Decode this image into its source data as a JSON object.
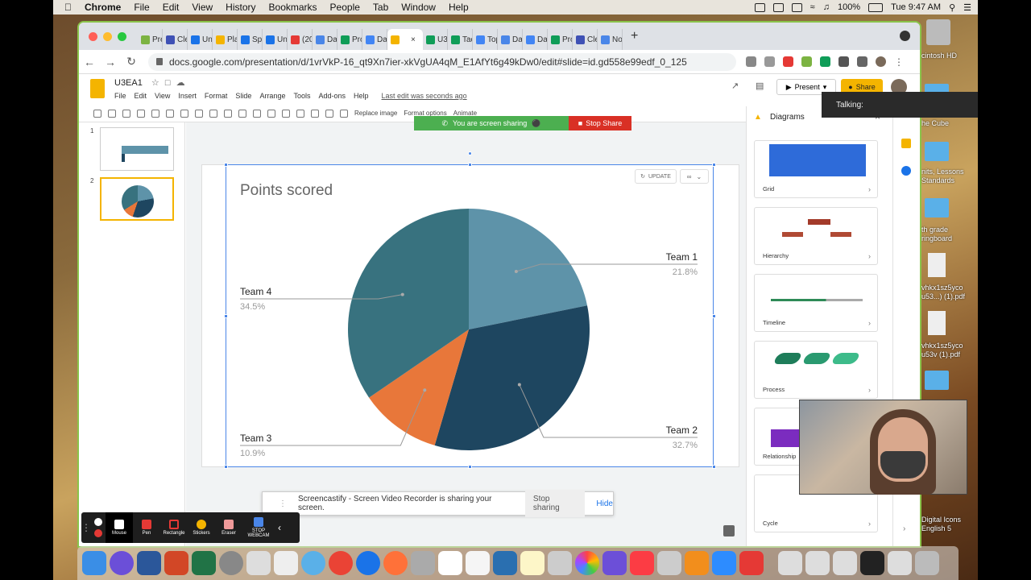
{
  "menubar": {
    "apple": "",
    "items": [
      "Chrome",
      "File",
      "Edit",
      "View",
      "History",
      "Bookmarks",
      "People",
      "Tab",
      "Window",
      "Help"
    ],
    "battery": "100%",
    "clock": "Tue 9:47 AM"
  },
  "tabs": [
    {
      "label": "Pre",
      "color": "#7cb342"
    },
    {
      "label": "Cle",
      "color": "#3f51b5"
    },
    {
      "label": "Un",
      "color": "#1a73e8"
    },
    {
      "label": "Pla",
      "color": "#f4b400"
    },
    {
      "label": "Sp",
      "color": "#1a73e8"
    },
    {
      "label": "Un",
      "color": "#1a73e8"
    },
    {
      "label": "(20",
      "color": "#e53935"
    },
    {
      "label": "Da",
      "color": "#4a86e8"
    },
    {
      "label": "Pro",
      "color": "#0f9d58"
    },
    {
      "label": "Da",
      "color": "#4285f4"
    },
    {
      "label": "",
      "color": "#f4b400",
      "active": true
    },
    {
      "label": "U3",
      "color": "#0f9d58"
    },
    {
      "label": "Tac",
      "color": "#0f9d58"
    },
    {
      "label": "Top",
      "color": "#4285f4"
    },
    {
      "label": "Da",
      "color": "#4a86e8"
    },
    {
      "label": "Da",
      "color": "#4285f4"
    },
    {
      "label": "Pro",
      "color": "#0f9d58"
    },
    {
      "label": "Cle",
      "color": "#3f51b5"
    },
    {
      "label": "No",
      "color": "#4a86e8"
    }
  ],
  "omnibox": {
    "url": "docs.google.com/presentation/d/1vrVkP-16_qt9Xn7ier-xkVgUA4qM_E1AfYt6g49kDw0/edit#slide=id.gd558e99edf_0_125"
  },
  "doc": {
    "title": "U3EA1",
    "menu": [
      "File",
      "Edit",
      "View",
      "Insert",
      "Format",
      "Slide",
      "Arrange",
      "Tools",
      "Add-ons",
      "Help"
    ],
    "last_edit": "Last edit was seconds ago",
    "present_label": "Present",
    "share_label": "Share"
  },
  "toolbar_labels": {
    "replace_image": "Replace image",
    "format_options": "Format options",
    "animate": "Animate"
  },
  "screen_share": {
    "message": "You are screen sharing",
    "stop": "Stop Share"
  },
  "chart_buttons": {
    "update": "UPDATE"
  },
  "chart_data": {
    "type": "pie",
    "title": "Points scored",
    "series": [
      {
        "name": "Team 1",
        "value": 21.8,
        "label": "21.8%",
        "color": "#5e93a9"
      },
      {
        "name": "Team 2",
        "value": 32.7,
        "label": "32.7%",
        "color": "#1e4660"
      },
      {
        "name": "Team 3",
        "value": 10.9,
        "label": "10.9%",
        "color": "#e8773a"
      },
      {
        "name": "Team 4",
        "value": 34.5,
        "label": "34.5%",
        "color": "#38727f"
      }
    ]
  },
  "filmstrip": {
    "slides": [
      "1",
      "2"
    ]
  },
  "diagrams": {
    "title": "Diagrams",
    "items": [
      "Grid",
      "Hierarchy",
      "Timeline",
      "Process",
      "Relationship",
      "Cycle"
    ]
  },
  "talking": "Talking:",
  "notice": {
    "text": "Screencastify - Screen Video Recorder is sharing your screen.",
    "stop": "Stop sharing",
    "hide": "Hide"
  },
  "screencastify_tools": [
    {
      "label": "Mouse",
      "color": "#ffffff"
    },
    {
      "label": "Pen",
      "color": "#e53935"
    },
    {
      "label": "Rectangle",
      "color": "#e53935"
    },
    {
      "label": "Stickers",
      "color": "#f4b400"
    },
    {
      "label": "Eraser",
      "color": "#ef9a9a"
    },
    {
      "label": "STOP WEBCAM",
      "color": "#4a86e8"
    }
  ],
  "desktop_icons": [
    "cintosh HD",
    "he Cube",
    "nits, Lessons Standards",
    "th grade ringboard",
    "vhkx1sz5yco u53...) (1).pdf",
    "vhkx1sz5yco u53v (1).pdf",
    "Digital Icons English 5"
  ]
}
